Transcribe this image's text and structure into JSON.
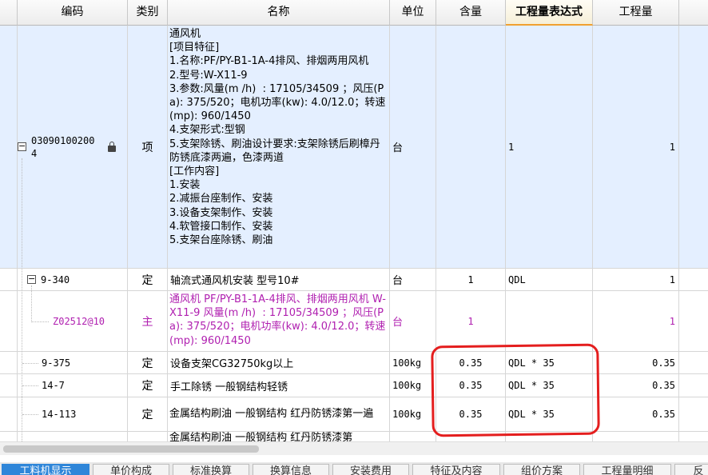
{
  "columns": {
    "code": "编码",
    "type": "类别",
    "name": "名称",
    "unit": "单位",
    "content": "含量",
    "expr": "工程量表达式",
    "qty": "工程量"
  },
  "rows": [
    {
      "code": "030901002004",
      "type": "项",
      "name": "通风机\n[项目特征]\n1.名称:PF/PY-B1-1A-4排风、排烟两用风机\n2.型号:W-X11-9\n3.参数:风量(m /h)  : 17105/34509 ；风压(Pa): 375/520；电机功率(kw): 4.0/12.0；转速(mp): 960/1450\n4.支架形式:型钢\n5.支架除锈、刷油设计要求:支架除锈后刷樟丹防锈底漆两遍，色漆两道\n[工作内容]\n1.安装\n2.减振台座制作、安装\n3.设备支架制作、安装\n4.软管接口制作、安装\n5.支架台座除锈、刷油",
      "unit": "台",
      "content": "",
      "expr": "1",
      "qty": "1"
    },
    {
      "code": "9-340",
      "type": "定",
      "name": "轴流式通风机安装 型号10#",
      "unit": "台",
      "content": "1",
      "expr": "QDL",
      "qty": "1"
    },
    {
      "code": "Z02512@10",
      "type": "主",
      "name": "通风机 PF/PY-B1-1A-4排风、排烟两用风机 W-X11-9 风量(m /h)  : 17105/34509 ；风压(Pa): 375/520；电机功率(kw): 4.0/12.0；转速(mp): 960/1450",
      "unit": "台",
      "content": "1",
      "expr": "",
      "qty": "1"
    },
    {
      "code": "9-375",
      "type": "定",
      "name": "设备支架CG32750kg以上",
      "unit": "100kg",
      "content": "0.35",
      "expr": "QDL * 35",
      "qty": "0.35"
    },
    {
      "code": "14-7",
      "type": "定",
      "name": "手工除锈 一般钢结构轻锈",
      "unit": "100kg",
      "content": "0.35",
      "expr": "QDL * 35",
      "qty": "0.35"
    },
    {
      "code": "14-113",
      "type": "定",
      "name": "金属结构刷油 一般钢结构 红丹防锈漆第一遍",
      "unit": "100kg",
      "content": "0.35",
      "expr": "QDL * 35",
      "qty": "0.35"
    },
    {
      "code": "",
      "type": "",
      "name": "金属结构刷油 一般钢结构 红丹防锈漆第",
      "unit": "",
      "content": "",
      "expr": "",
      "qty": ""
    }
  ],
  "tabs": [
    "工料机显示",
    "单价构成",
    "标准换算",
    "换算信息",
    "安装费用",
    "特征及内容",
    "组价方案",
    "工程量明细",
    "反"
  ],
  "colors": {
    "selected_row": "#e4efff",
    "main_material_text": "#b020b0",
    "annotation": "#e41e1e",
    "active_tab": "#2f86d9"
  }
}
